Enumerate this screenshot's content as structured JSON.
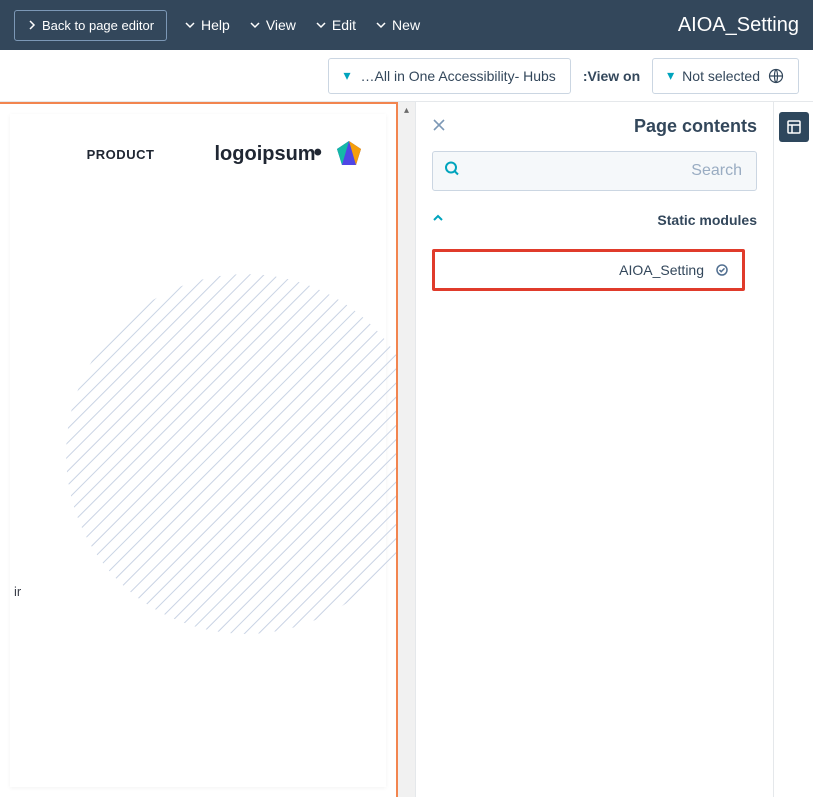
{
  "topbar": {
    "title": "AIOA_Setting",
    "menu": {
      "new": "New",
      "edit": "Edit",
      "view": "View",
      "help": "Help"
    },
    "back": "Back to page editor"
  },
  "toolbar": {
    "not_selected": "Not selected",
    "view_on_label": "View on:",
    "view_on_value": "All in One Accessibility- Hubs…"
  },
  "panel": {
    "title": "Page contents",
    "search_placeholder": "Search",
    "section_static": "Static modules",
    "module_aioa": "AIOA_Setting"
  },
  "page": {
    "logo_text": "logoipsum",
    "nav_product": "PRODUCT",
    "stray_text": "ir"
  }
}
